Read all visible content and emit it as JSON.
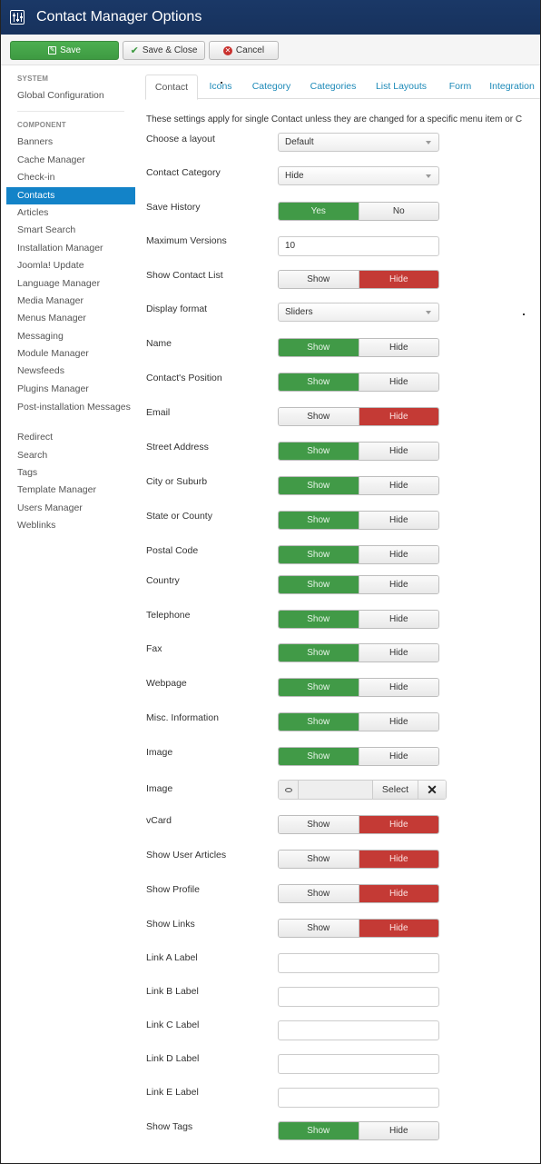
{
  "header": {
    "title": "Contact Manager Options",
    "icon": "options-sliders-icon"
  },
  "toolbar": {
    "save_label": "Save",
    "save_close_label": "Save & Close",
    "cancel_label": "Cancel"
  },
  "sidebar": {
    "system_heading": "SYSTEM",
    "system_items": [
      "Global Configuration"
    ],
    "component_heading": "COMPONENT",
    "component_items": [
      "Banners",
      "Cache Manager",
      "Check-in",
      "Contacts",
      "Articles",
      "Smart Search",
      "Installation Manager",
      "Joomla! Update",
      "Language Manager",
      "Media Manager",
      "Menus Manager",
      "Messaging",
      "Module Manager",
      "Newsfeeds",
      "Plugins Manager",
      "Post-installation Messages",
      "Redirect",
      "Search",
      "Tags",
      "Template Manager",
      "Users Manager",
      "Weblinks"
    ],
    "active_item": "Contacts"
  },
  "tabs": [
    "Contact",
    "Icons",
    "Category",
    "Categories",
    "List Layouts",
    "Form",
    "Integration"
  ],
  "active_tab": "Contact",
  "intro": "These settings apply for single Contact unless they are changed for a specific menu item or C",
  "colors": {
    "header": "#17325d",
    "green": "#419a47",
    "red": "#c43a35",
    "active": "#1383c8",
    "link": "#1d8ab8"
  },
  "fields": [
    {
      "label": "Choose a layout",
      "type": "select",
      "value": "Default"
    },
    {
      "label": "Contact Category",
      "type": "select",
      "value": "Hide"
    },
    {
      "label": "Save History",
      "type": "toggle",
      "options": [
        "Yes",
        "No"
      ],
      "selected": "Yes"
    },
    {
      "label": "Maximum Versions",
      "type": "text",
      "value": "10"
    },
    {
      "label": "Show Contact List",
      "type": "toggle",
      "options": [
        "Show",
        "Hide"
      ],
      "selected": "Hide"
    },
    {
      "label": "Display format",
      "type": "select",
      "value": "Sliders"
    },
    {
      "label": "Name",
      "type": "toggle",
      "options": [
        "Show",
        "Hide"
      ],
      "selected": "Show"
    },
    {
      "label": "Contact's Position",
      "type": "toggle",
      "options": [
        "Show",
        "Hide"
      ],
      "selected": "Show"
    },
    {
      "label": "Email",
      "type": "toggle",
      "options": [
        "Show",
        "Hide"
      ],
      "selected": "Hide"
    },
    {
      "label": "Street Address",
      "type": "toggle",
      "options": [
        "Show",
        "Hide"
      ],
      "selected": "Show"
    },
    {
      "label": "City or Suburb",
      "type": "toggle",
      "options": [
        "Show",
        "Hide"
      ],
      "selected": "Show"
    },
    {
      "label": "State or County",
      "type": "toggle",
      "options": [
        "Show",
        "Hide"
      ],
      "selected": "Show"
    },
    {
      "label": "Postal Code",
      "type": "toggle",
      "options": [
        "Show",
        "Hide"
      ],
      "selected": "Show"
    },
    {
      "label": "Country",
      "type": "toggle",
      "options": [
        "Show",
        "Hide"
      ],
      "selected": "Show"
    },
    {
      "label": "Telephone",
      "type": "toggle",
      "options": [
        "Show",
        "Hide"
      ],
      "selected": "Show"
    },
    {
      "label": "Fax",
      "type": "toggle",
      "options": [
        "Show",
        "Hide"
      ],
      "selected": "Show"
    },
    {
      "label": "Webpage",
      "type": "toggle",
      "options": [
        "Show",
        "Hide"
      ],
      "selected": "Show"
    },
    {
      "label": "Misc. Information",
      "type": "toggle",
      "options": [
        "Show",
        "Hide"
      ],
      "selected": "Show"
    },
    {
      "label": "Image",
      "type": "toggle",
      "options": [
        "Show",
        "Hide"
      ],
      "selected": "Show"
    },
    {
      "label": "Image",
      "type": "media",
      "value": "",
      "select_label": "Select",
      "clear_label": "✕"
    },
    {
      "label": "vCard",
      "type": "toggle",
      "options": [
        "Show",
        "Hide"
      ],
      "selected": "Hide"
    },
    {
      "label": "Show User Articles",
      "type": "toggle",
      "options": [
        "Show",
        "Hide"
      ],
      "selected": "Hide"
    },
    {
      "label": "Show Profile",
      "type": "toggle",
      "options": [
        "Show",
        "Hide"
      ],
      "selected": "Hide"
    },
    {
      "label": "Show Links",
      "type": "toggle",
      "options": [
        "Show",
        "Hide"
      ],
      "selected": "Hide"
    },
    {
      "label": "Link A Label",
      "type": "text",
      "value": ""
    },
    {
      "label": "Link B Label",
      "type": "text",
      "value": ""
    },
    {
      "label": "Link C Label",
      "type": "text",
      "value": ""
    },
    {
      "label": "Link D Label",
      "type": "text",
      "value": ""
    },
    {
      "label": "Link E Label",
      "type": "text",
      "value": ""
    },
    {
      "label": "Show Tags",
      "type": "toggle",
      "options": [
        "Show",
        "Hide"
      ],
      "selected": "Show"
    }
  ]
}
